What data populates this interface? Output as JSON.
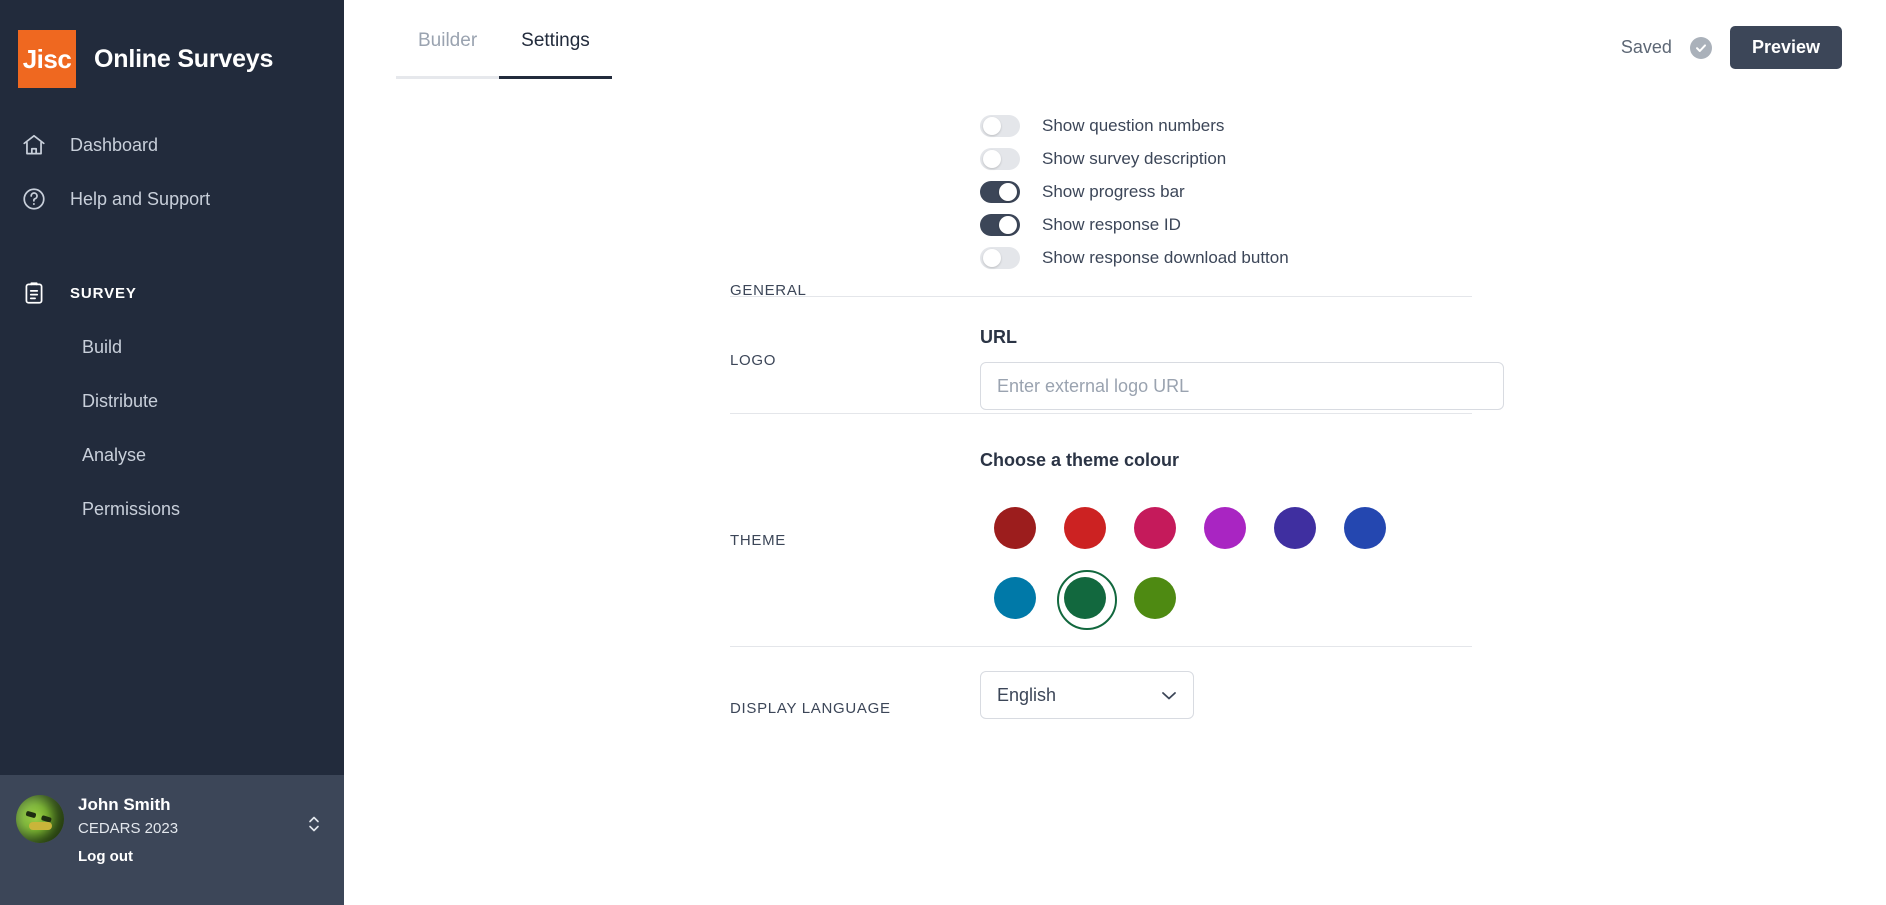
{
  "sidebar": {
    "brand": {
      "logo_text": "Jisc",
      "title": "Online Surveys"
    },
    "nav": [
      {
        "label": "Dashboard",
        "icon": "home-icon"
      },
      {
        "label": "Help and Support",
        "icon": "question-circle-icon"
      }
    ],
    "section": {
      "label": "SURVEY",
      "icon": "clipboard-icon"
    },
    "sub_items": [
      {
        "label": "Build"
      },
      {
        "label": "Distribute"
      },
      {
        "label": "Analyse"
      },
      {
        "label": "Permissions"
      }
    ],
    "user": {
      "name": "John Smith",
      "org": "CEDARS 2023",
      "logout": "Log out"
    }
  },
  "topbar": {
    "tabs": [
      {
        "label": "Builder",
        "active": false
      },
      {
        "label": "Settings",
        "active": true
      }
    ],
    "saved_label": "Saved",
    "preview_label": "Preview"
  },
  "general": {
    "label": "GENERAL",
    "toggles": [
      {
        "label": "Show question numbers",
        "on": false
      },
      {
        "label": "Show survey description",
        "on": false
      },
      {
        "label": "Show progress bar",
        "on": true
      },
      {
        "label": "Show response ID",
        "on": true
      },
      {
        "label": "Show response download button",
        "on": false
      }
    ]
  },
  "logo": {
    "label": "LOGO",
    "url_label": "URL",
    "url_value": "",
    "url_placeholder": "Enter external logo URL"
  },
  "theme": {
    "label": "THEME",
    "title": "Choose a theme colour",
    "swatches": [
      {
        "name": "dark-red",
        "color": "#9c1d1d",
        "selected": false
      },
      {
        "name": "red",
        "color": "#cc2222",
        "selected": false
      },
      {
        "name": "crimson",
        "color": "#c51a5b",
        "selected": false
      },
      {
        "name": "magenta",
        "color": "#a925c2",
        "selected": false
      },
      {
        "name": "indigo",
        "color": "#3f2fa0",
        "selected": false
      },
      {
        "name": "blue",
        "color": "#2447b0",
        "selected": false
      },
      {
        "name": "teal-blue",
        "color": "#0079a8",
        "selected": false
      },
      {
        "name": "green",
        "color": "#12683e",
        "selected": true
      },
      {
        "name": "olive",
        "color": "#4e8a12",
        "selected": false
      }
    ]
  },
  "language": {
    "label": "DISPLAY LANGUAGE",
    "selected": "English"
  },
  "colors": {
    "sidebar_bg": "#222b3c",
    "brand_orange": "#ef6820",
    "accent_dark": "#3c4658"
  }
}
